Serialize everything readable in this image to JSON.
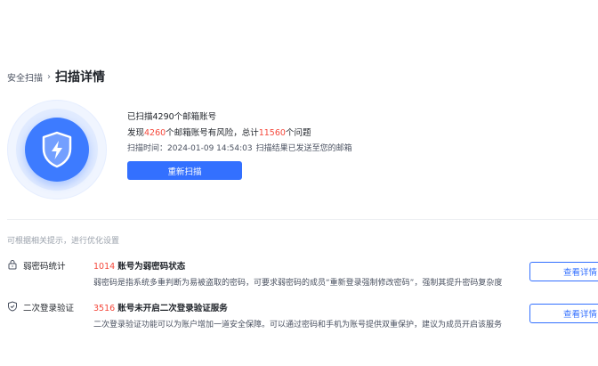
{
  "breadcrumb": {
    "parent": "安全扫描",
    "separator": "›",
    "current": "扫描详情"
  },
  "summary": {
    "line1": "已扫描4290个邮箱账号",
    "line2_prefix": "发现",
    "line2_risky": "4260",
    "line2_mid": "个邮箱账号有风险，总计",
    "line2_issues": "11560",
    "line2_suffix": "个问题",
    "meta_label": "扫描时间：",
    "meta_time": "2024-01-09 14:54:03",
    "meta_note": "扫描结果已发送至您的邮箱",
    "rescan_label": "重新扫描"
  },
  "hint": "可根据相关提示，进行优化设置",
  "items": [
    {
      "name": "弱密码统计",
      "count": "1014",
      "title": "账号为弱密码状态",
      "desc": "弱密码是指系统多重判断为易被盗取的密码，可要求弱密码的成员“重新登录强制修改密码”，强制其提升密码复杂度",
      "button": "查看详情",
      "icon": "lock-icon"
    },
    {
      "name": "二次登录验证",
      "count": "3516",
      "title": "账号未开启二次登录验证服务",
      "desc": "二次登录验证功能可以为账户增加一道安全保障。可以通过密码和手机为账号提供双重保护，建议为成员开启该服务",
      "button": "查看详情",
      "icon": "shield-check-icon"
    }
  ],
  "colors": {
    "primary": "#3370ff",
    "danger": "#f5483b",
    "shield": "#3d7bff"
  }
}
